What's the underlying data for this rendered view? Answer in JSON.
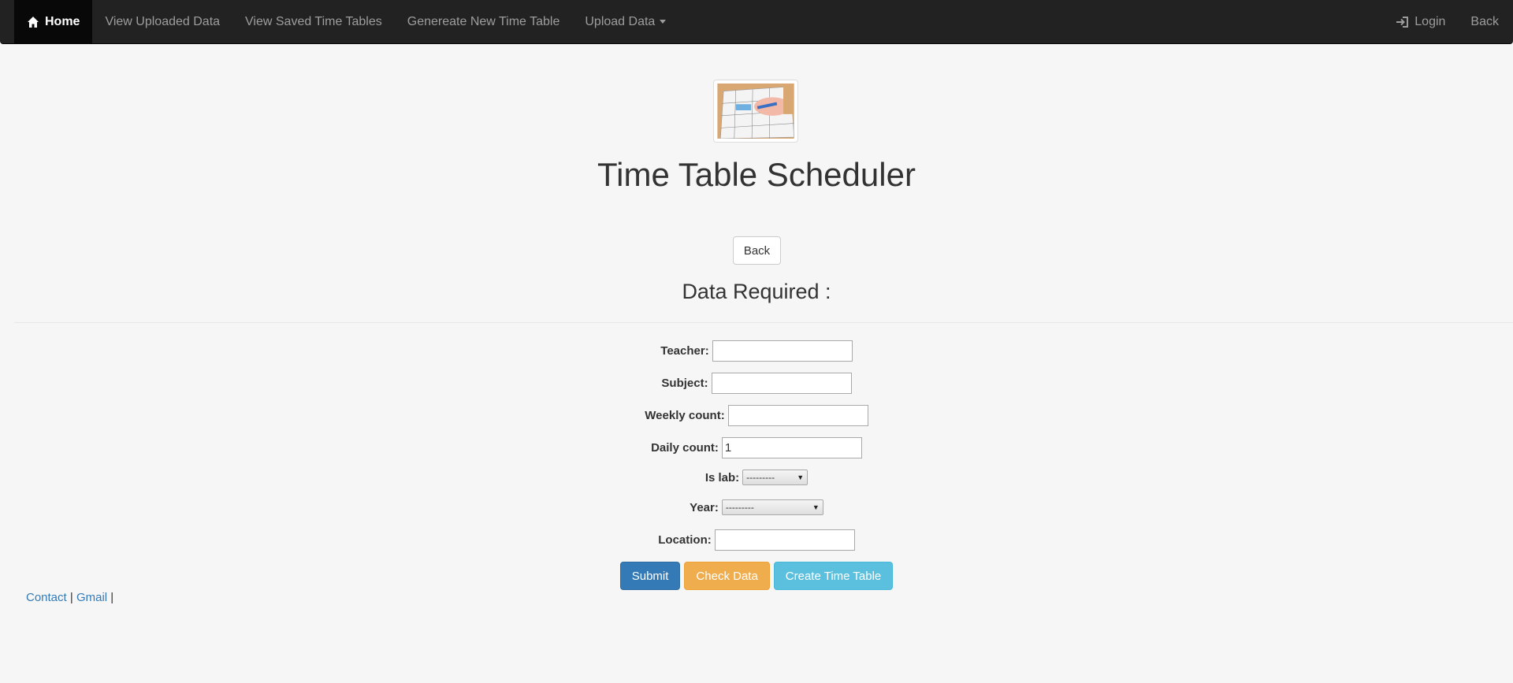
{
  "nav": {
    "home": "Home",
    "view_uploaded": "View Uploaded Data",
    "view_saved": "View Saved Time Tables",
    "generate": "Genereate New Time Table",
    "upload": "Upload Data",
    "login": "Login",
    "back": "Back"
  },
  "header": {
    "title": "Time Table Scheduler",
    "back_button": "Back",
    "section_title": "Data Required :"
  },
  "form": {
    "teacher_label": "Teacher:",
    "teacher_value": "",
    "subject_label": "Subject:",
    "subject_value": "",
    "weekly_label": "Weekly count:",
    "weekly_value": "",
    "daily_label": "Daily count:",
    "daily_value": "1",
    "islab_label": "Is lab:",
    "islab_selected": "---------",
    "year_label": "Year:",
    "year_selected": "---------",
    "location_label": "Location:",
    "location_value": ""
  },
  "buttons": {
    "submit": "Submit",
    "check": "Check Data",
    "create": "Create Time Table"
  },
  "footer": {
    "contact": "Contact",
    "sep1": " | ",
    "gmail": "Gmail",
    "sep2": " |"
  },
  "colors": {
    "navbar": "#222222",
    "primary": "#337ab7",
    "warning": "#f0ad4e",
    "info": "#5bc0de"
  }
}
